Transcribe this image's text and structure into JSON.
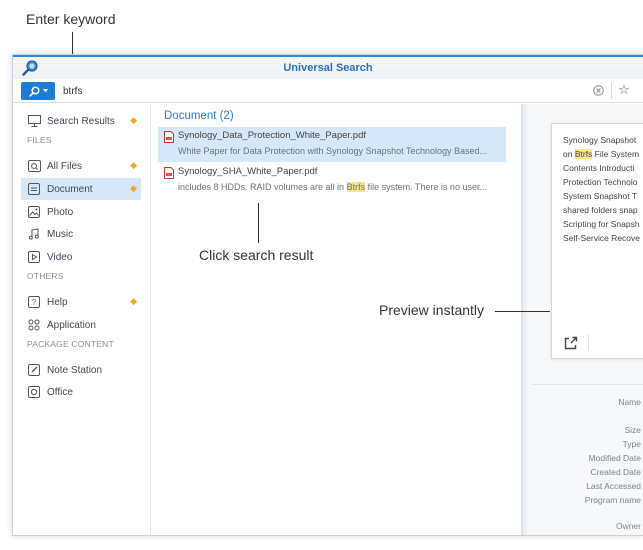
{
  "annotations": {
    "enter_keyword": "Enter keyword",
    "click_result": "Click search result",
    "preview_instantly": "Preview instantly"
  },
  "window": {
    "title": "Universal Search"
  },
  "search": {
    "value": "btrfs"
  },
  "sidebar": {
    "search_results": "Search Results",
    "files_label": "FILES",
    "files": [
      {
        "label": "All Files",
        "icon": "folder-search-icon"
      },
      {
        "label": "Document",
        "icon": "document-icon"
      },
      {
        "label": "Photo",
        "icon": "photo-icon"
      },
      {
        "label": "Music",
        "icon": "music-icon"
      },
      {
        "label": "Video",
        "icon": "video-icon"
      }
    ],
    "others_label": "OTHERS",
    "others": [
      {
        "label": "Help",
        "icon": "help-icon"
      },
      {
        "label": "Application",
        "icon": "application-icon"
      }
    ],
    "package_label": "PACKAGE CONTENT",
    "packages": [
      {
        "label": "Note Station",
        "icon": "note-station-icon"
      },
      {
        "label": "Office",
        "icon": "office-icon"
      }
    ]
  },
  "results": {
    "heading": "Document (2)",
    "items": [
      {
        "name": "Synology_Data_Protection_White_Paper.pdf",
        "snippet": "White Paper for Data Protection with Synology Snapshot Technology Based..."
      },
      {
        "name": "Synology_SHA_White_Paper.pdf",
        "snippet_before": "includes 8 HDDs. RAID volumes are all in ",
        "snippet_highlight": "Btrfs",
        "snippet_after": " file system. There is no user..."
      }
    ]
  },
  "preview": {
    "lines": [
      {
        "text": "Synology Snapshot"
      },
      {
        "before": "on ",
        "highlight": "Btrfs",
        "after": " File System"
      },
      {
        "text": "Contents Introducti"
      },
      {
        "text": "Protection Technolo"
      },
      {
        "text": "System Snapshot T"
      },
      {
        "text": "shared folders snap"
      },
      {
        "text": "Scripting for Snapsh"
      },
      {
        "text": "Self-Service Recove"
      }
    ],
    "properties": [
      "Name",
      "Size",
      "Type",
      "Modified Date",
      "Created Date",
      "Last Accessed",
      "Program name",
      "Owner"
    ]
  },
  "colors": {
    "accent": "#1f7cd6",
    "selection": "#d6e8f8",
    "highlight": "#f8e58a",
    "badge": "#f5a623"
  }
}
